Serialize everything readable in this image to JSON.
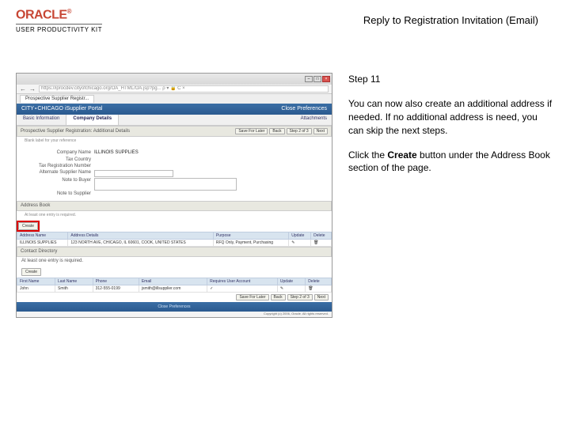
{
  "header": {
    "brand": "ORACLE",
    "brand_reg": "®",
    "subbrand": "USER PRODUCTIVITY KIT",
    "page_title": "Reply to Registration Invitation (Email)"
  },
  "instruction": {
    "step_label": "Step 11",
    "para1": "You can now also create an additional address if needed. If no additional address is need, you can skip the next steps.",
    "para2_pre": "Click the ",
    "para2_bold": "Create",
    "para2_post": " button under the Address Book section of the page."
  },
  "shot": {
    "url_text": "https://iprocdev.cityofchicago.org/OA_HTML/OA.jsp?pg...  ρ ▾ 🔒 C ×",
    "tab_label": "Prospective Supplier Registr...",
    "portal_left": "CITY∘CHICAGO   iSupplier Portal",
    "portal_right": "Close   Preferences",
    "nav": {
      "t1": "Basic Information",
      "t2": "Company Details",
      "t3": "Attachments"
    },
    "section_title": "Prospective Supplier Registration: Additional Details",
    "section_hint": "Blank label for your reference",
    "btn_save": "Save For Later",
    "btn_back": "Back",
    "btn_step": "Step 2 of 3",
    "btn_next": "Next",
    "form": {
      "company_label": "Company Name",
      "company_val": "ILLINOIS SUPPLIES",
      "tax_country_label": "Tax Country",
      "tax_country_val": "",
      "tax_id_label": "Tax Registration Number",
      "tax_id_val": "",
      "alt_name_label": "Alternate Supplier Name",
      "alt_name_val": "",
      "note_label": "Note to Buyer",
      "note_val": "",
      "note_to_supplier_label": "Note to Supplier"
    },
    "addr_section": "Address Book",
    "addr_hint": "At least one entry is required.",
    "create_label": "Create",
    "addr_table": {
      "h1": "Address Name",
      "h2": "Address Details",
      "h3": "Purpose",
      "h4": "Update",
      "h5": "Delete",
      "r1c1": "ILLINOIS SUPPLIES",
      "r1c2": "123 NORTH AVE, CHICAGO, IL 60601, COOK, UNITED STATES",
      "r1c3": "RFQ Only, Payment, Purchasing"
    },
    "contact_section": "Contact Directory",
    "contact_req": "At least one entry is required.",
    "contact_create": "Create",
    "contact_table": {
      "h1": "First Name",
      "h2": "Last Name",
      "h3": "Phone",
      "h4": "Email",
      "h5": "Requires User Account",
      "h6": "Update",
      "h7": "Delete",
      "r1c1": "John",
      "r1c2": "Smith",
      "r1c3": "312-555-0199",
      "r1c4": "jsmith@illsupplier.com",
      "r1c5": "✓"
    },
    "bottom_btns": {
      "save": "Save For Later",
      "back": "Back",
      "step": "Step 2 of 3",
      "next": "Next"
    },
    "footer_links": "Close    Preferences",
    "copyright": "Copyright (c) 2006, Oracle. All rights reserved."
  }
}
